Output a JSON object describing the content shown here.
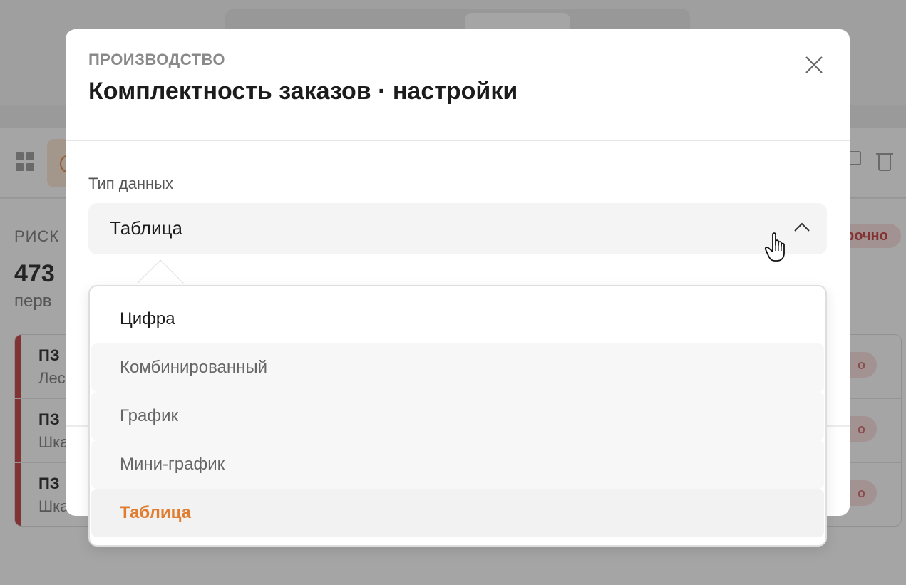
{
  "background": {
    "risk_label": "РИСК",
    "count": "473 ",
    "subtitle": "перв",
    "urgent_badge": "рочно",
    "rows": [
      {
        "code": "ПЗ",
        "name": "Лес",
        "pill": "о"
      },
      {
        "code": "ПЗ",
        "name": "Шка",
        "pill": "о"
      },
      {
        "code": "ПЗ",
        "name": "Шка",
        "pill": "о"
      }
    ]
  },
  "modal": {
    "eyebrow": "ПРОИЗВОДСТВО",
    "title": "Комплектность заказов · настройки",
    "field_label": "Тип данных",
    "selected_value": "Таблица"
  },
  "dropdown": {
    "options": [
      {
        "label": "Цифра"
      },
      {
        "label": "Комбинированный"
      },
      {
        "label": "График"
      },
      {
        "label": "Мини-график"
      },
      {
        "label": "Таблица"
      }
    ],
    "selected_index": 4
  },
  "colors": {
    "accent": "#e07d31",
    "danger": "#c23b3b"
  }
}
